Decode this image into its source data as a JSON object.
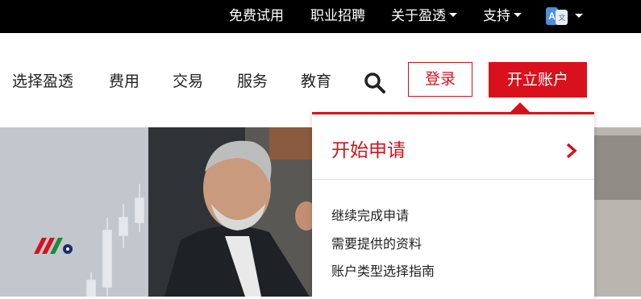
{
  "topbar": {
    "free_trial": "免费试用",
    "careers": "职业招聘",
    "about": "关于盈透",
    "support": "支持",
    "language_icon": "translate-icon"
  },
  "nav": {
    "items": [
      "选择盈透",
      "费用",
      "交易",
      "服务",
      "教育"
    ],
    "search_icon": "search-icon",
    "login": "登录",
    "open_account": "开立账户"
  },
  "dropdown": {
    "heading": "开始申请",
    "links": [
      "继续完成申请",
      "需要提供的资料",
      "账户类型选择指南"
    ]
  },
  "colors": {
    "brand_red": "#d8111d",
    "topbar_bg": "#000000",
    "nav_text": "#222222"
  }
}
